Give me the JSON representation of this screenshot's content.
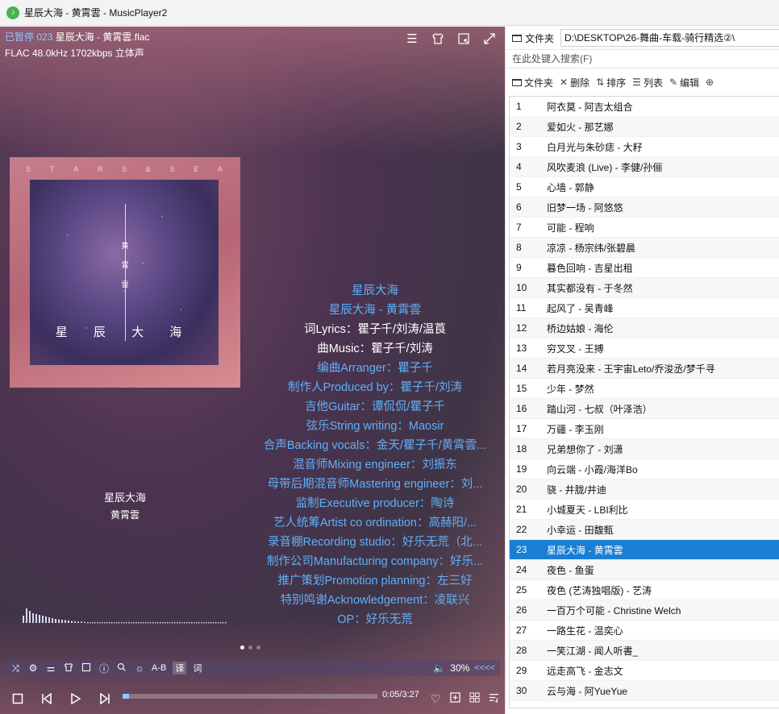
{
  "window": {
    "title": "星辰大海 - 黄霄雲 - MusicPlayer2",
    "icon": "music-note-icon"
  },
  "player": {
    "status": "已暂停",
    "track_index": "023",
    "filename": "星辰大海 - 黄霄雲.flac",
    "format_info": "FLAC 48.0kHz 1702kbps 立体声",
    "cover": {
      "letters": [
        "S",
        "T",
        "A",
        "R",
        "S",
        "&",
        "S",
        "E",
        "A"
      ],
      "title": "星 辰 大 海",
      "vertical_text": "黄 霄 雲"
    },
    "song_name": "星辰大海",
    "artist": "黄霄雲",
    "lyrics": [
      {
        "text": "星辰大海",
        "white": false
      },
      {
        "text": "星辰大海 - 黄霄雲",
        "white": false
      },
      {
        "text": "词Lyrics：瞿子千/刘涛/温莨",
        "white": true
      },
      {
        "text": "曲Music：瞿子千/刘涛",
        "white": true
      },
      {
        "text": "编曲Arranger：瞿子千",
        "white": false
      },
      {
        "text": "制作人Produced by：瞿子千/刘涛",
        "white": false
      },
      {
        "text": "吉他Guitar：谭侃侃/瞿子千",
        "white": false
      },
      {
        "text": "弦乐String writing：Maosir",
        "white": false
      },
      {
        "text": "合声Backing vocals：金天/瞿子千/黄霄雲...",
        "white": false
      },
      {
        "text": "混音师Mixing engineer：刘振东",
        "white": false
      },
      {
        "text": "母带后期混音师Mastering engineer：刘...",
        "white": false
      },
      {
        "text": "监制Executive producer：陶诗",
        "white": false
      },
      {
        "text": "艺人统筹Artist co ordination：高赫阳/...",
        "white": false
      },
      {
        "text": "录音棚Recording studio：好乐无荒（北...",
        "white": false
      },
      {
        "text": "制作公司Manufacturing company：好乐...",
        "white": false
      },
      {
        "text": "推广策划Promotion planning：左三好",
        "white": false
      },
      {
        "text": "特别鸣谢Acknowledgement：凌联兴",
        "white": false
      },
      {
        "text": "OP：好乐无荒",
        "white": false
      }
    ],
    "spectrum_levels": [
      0.45,
      0.9,
      0.75,
      0.6,
      0.55,
      0.5,
      0.45,
      0.4,
      0.35,
      0.3,
      0.25,
      0.22,
      0.2,
      0.18,
      0.15,
      0.12,
      0.1,
      0.08,
      0.08,
      0.06
    ],
    "toolbar": {
      "ab_label": "A-B",
      "translate_label": "译",
      "lyric_label": "词",
      "volume": "30%",
      "arrows": "<<<<"
    },
    "time": "0:05/3:27",
    "progress": 0.024
  },
  "sidebar": {
    "folder_label": "文件夹",
    "path": "D:\\DESKTOP\\26-舞曲-车载-骑行精选②\\",
    "search_placeholder": "在此处键入搜索(F)",
    "toolbar": {
      "folder": "文件夹",
      "delete": "删除",
      "sort": "排序",
      "list": "列表",
      "edit": "编辑"
    },
    "active_index": 23,
    "tracks": [
      {
        "num": "1",
        "name": "阿衣莫 - 阿吉太组合"
      },
      {
        "num": "2",
        "name": "爱如火 - 那艺娜"
      },
      {
        "num": "3",
        "name": "白月光与朱砂痣 - 大籽"
      },
      {
        "num": "4",
        "name": "风吹麦浪 (Live) - 李健/孙俪"
      },
      {
        "num": "5",
        "name": "心墙 - 郭静"
      },
      {
        "num": "6",
        "name": "旧梦一场 - 阿悠悠"
      },
      {
        "num": "7",
        "name": "可能 - 程响"
      },
      {
        "num": "8",
        "name": "凉凉 - 杨宗纬/张碧晨"
      },
      {
        "num": "9",
        "name": "暮色回响 - 吉星出租"
      },
      {
        "num": "10",
        "name": "其实都没有 - 于冬然"
      },
      {
        "num": "11",
        "name": "起风了 - 吴青峰"
      },
      {
        "num": "12",
        "name": "桥边姑娘 - 海伦"
      },
      {
        "num": "13",
        "name": "穷叉叉 - 王搏"
      },
      {
        "num": "14",
        "name": "若月亮没来 - 王宇宙Leto/乔浚丞/梦千寻"
      },
      {
        "num": "15",
        "name": "少年 - 梦然"
      },
      {
        "num": "16",
        "name": "踏山河 - 七叔（叶泽浩）"
      },
      {
        "num": "17",
        "name": "万疆 - 李玉刚"
      },
      {
        "num": "18",
        "name": "兄弟想你了 - 刘潇"
      },
      {
        "num": "19",
        "name": "向云端 - 小霞/海洋Bo"
      },
      {
        "num": "20",
        "name": "骁 - 井胧/井迪"
      },
      {
        "num": "21",
        "name": "小城夏天 - LBI利比"
      },
      {
        "num": "22",
        "name": "小幸运 - 田馥甄"
      },
      {
        "num": "23",
        "name": "星辰大海 - 黄霄雲"
      },
      {
        "num": "24",
        "name": "夜色 - 鱼蛋"
      },
      {
        "num": "25",
        "name": "夜色 (艺涛独唱版) - 艺涛"
      },
      {
        "num": "26",
        "name": "一百万个可能 - Christine Welch"
      },
      {
        "num": "27",
        "name": "一路生花 - 温奕心"
      },
      {
        "num": "28",
        "name": "一笑江湖 - 闻人听書_"
      },
      {
        "num": "29",
        "name": "远走高飞 - 金志文"
      },
      {
        "num": "30",
        "name": "云与海 - 阿YueYue"
      }
    ]
  }
}
